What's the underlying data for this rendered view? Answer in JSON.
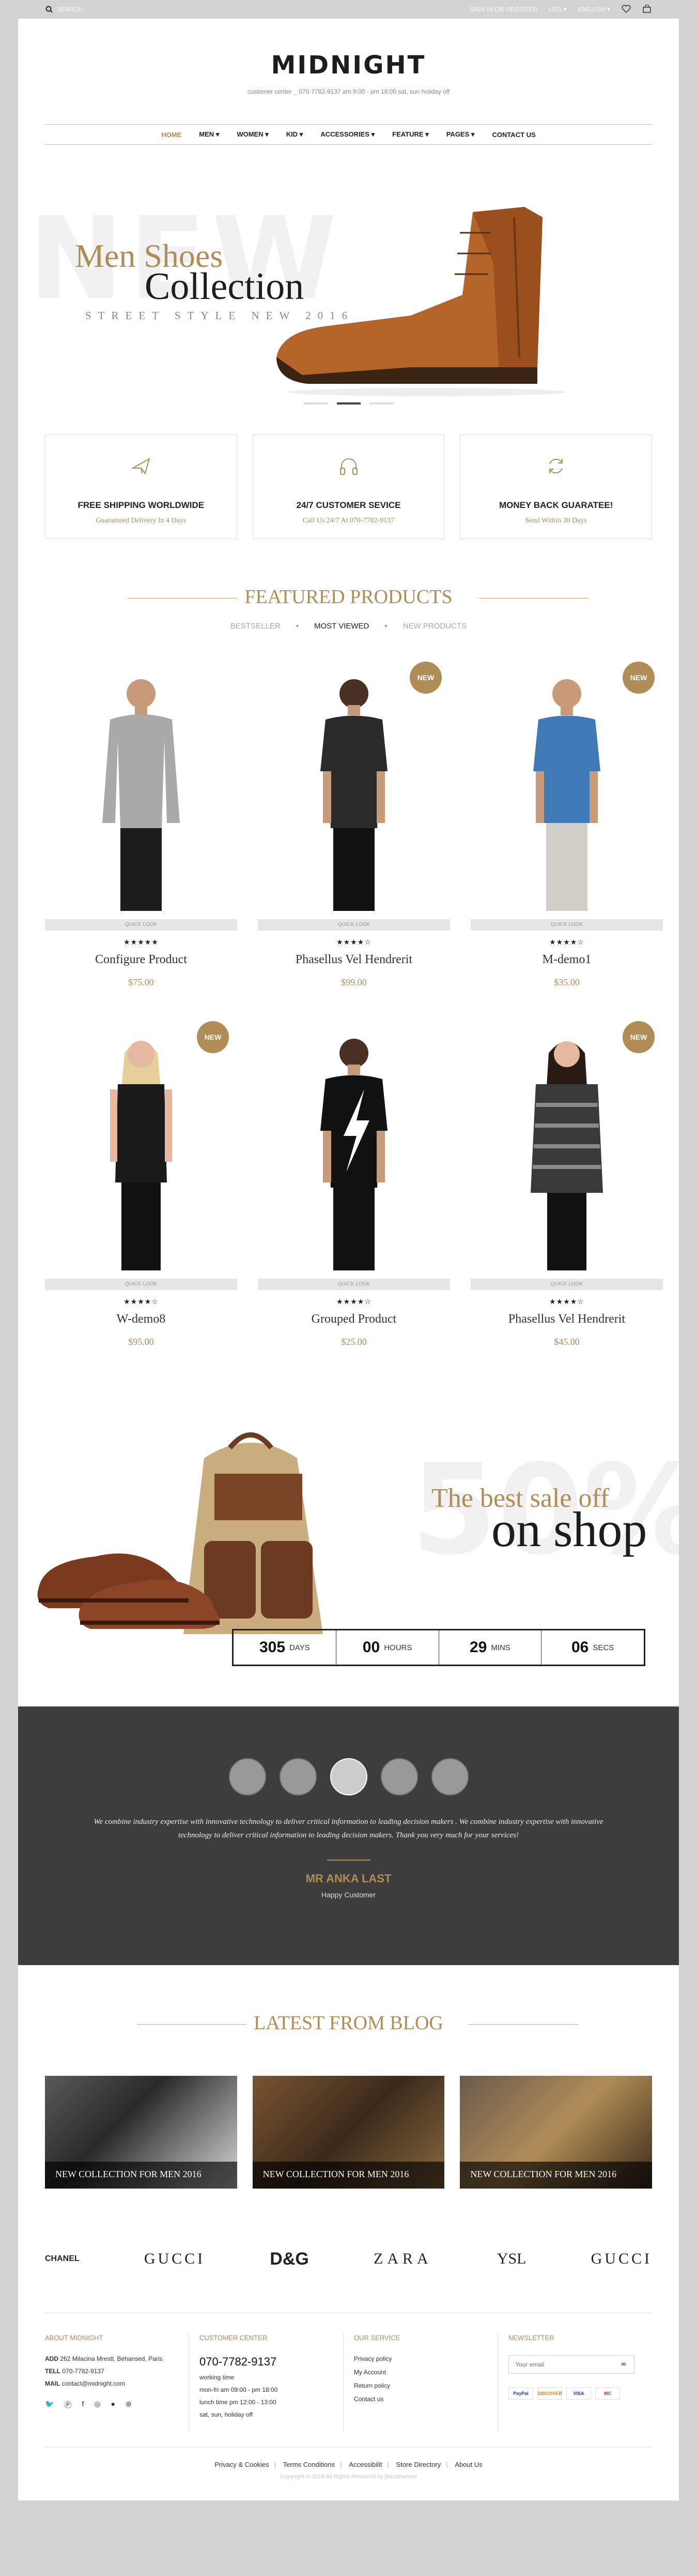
{
  "topbar": {
    "search_label": "SEARCH",
    "signin": "SIGN IN OR REGISTER",
    "currency": "USD",
    "language": "ENGLISH",
    "wishlist_count": "0",
    "cart_count": "0"
  },
  "header": {
    "logo": "MIDNIGHT",
    "tagline": "customer center _ 070-7782-9137 am 9:00 - pm 18:00 sat, sun holiday off"
  },
  "nav": {
    "items": [
      "HOME",
      "MEN",
      "WOMEN",
      "KID",
      "ACCESSORIES",
      "FEATURE",
      "PAGES",
      "CONTACT US"
    ],
    "dropdown_marker": "▾"
  },
  "hero": {
    "bg_word": "NEW",
    "title1": "Men Shoes",
    "title2": "Collection",
    "subtitle": "STREET STYLE NEW 2016"
  },
  "features": [
    {
      "title": "FREE SHIPPING WORLDWIDE",
      "sub": "Guaranteed Delivery In 4 Days",
      "icon": "airplane-icon"
    },
    {
      "title": "24/7 CUSTOMER SEVICE",
      "sub": "Call Us 24/7 At 070-7782-9137",
      "icon": "headphones-icon"
    },
    {
      "title": "MONEY BACK GUARATEE!",
      "sub": "Send Within 30 Days",
      "icon": "refresh-icon"
    }
  ],
  "featured": {
    "title": "FEATURED PRODUCTS",
    "tabs": [
      "BESTSELLER",
      "MOST VIEWED",
      "NEW PRODUCTS"
    ],
    "quick_look": "QUICK LOOK",
    "new_badge": "NEW",
    "products": [
      {
        "name": "Configure Product",
        "price": "$75.00",
        "rating": 5,
        "stars": "★★★★★",
        "isNew": false
      },
      {
        "name": "Phasellus Vel Hendrerit",
        "price": "$99.00",
        "rating": 4,
        "stars": "★★★★☆",
        "isNew": true
      },
      {
        "name": "M-demo1",
        "price": "$35.00",
        "rating": 4.5,
        "stars": "★★★★☆",
        "isNew": true
      },
      {
        "name": "W-demo8",
        "price": "$95.00",
        "rating": 4.5,
        "stars": "★★★★☆",
        "isNew": true
      },
      {
        "name": "Grouped Product",
        "price": "$25.00",
        "rating": 4,
        "stars": "★★★★☆",
        "isNew": false
      },
      {
        "name": "Phasellus Vel Hendrerit",
        "price": "$45.00",
        "rating": 4.5,
        "stars": "★★★★☆",
        "isNew": true
      }
    ]
  },
  "sale": {
    "bg_word": "50%",
    "title1": "The best sale off",
    "title2": "on shop",
    "countdown": [
      {
        "value": "305",
        "unit": "DAYS"
      },
      {
        "value": "00",
        "unit": "HOURS"
      },
      {
        "value": "29",
        "unit": "MINS"
      },
      {
        "value": "06",
        "unit": "SECS"
      }
    ]
  },
  "testimonial": {
    "quote": "We combine industry expertise with innovative technology to deliver critical information to leading decision makers . We combine industry expertise with innovative technology to deliver critical information to leading decision makers. Thank you very much for your services!",
    "author": "MR ANKA LAST",
    "role": "Happy Customer"
  },
  "blog": {
    "title": "LATEST FROM BLOG",
    "posts": [
      "NEW COLLECTION FOR MEN 2016",
      "NEW COLLECTION FOR MEN 2016",
      "NEW COLLECTION FOR MEN 2016"
    ]
  },
  "brands": [
    "CHANEL",
    "GUCCI",
    "D&G",
    "ZARA",
    "YSL",
    "GUCCI"
  ],
  "footer": {
    "about": {
      "title": "ABOUT MIDNIGHT",
      "add_label": "ADD",
      "add": "262 Milacina Mrestl, Behansed, Paris",
      "tell_label": "TELL",
      "tell": "070-7782-9137",
      "mail_label": "MAIL",
      "mail": "contact@midnight.com"
    },
    "center": {
      "title": "CUSTOMER CENTER",
      "phone": "070-7782-9137",
      "lines": [
        "working time",
        "mon-fri am 09:00 - pm 18:00",
        "lunch time pm 12:00 - 13:00",
        "sat, sun, holiday off"
      ]
    },
    "service": {
      "title": "OUR SERVICE",
      "links": [
        "Privacy policy",
        "My Account",
        "Return policy",
        "Contact us"
      ]
    },
    "newsletter": {
      "title": "NEWSLETTER",
      "placeholder": "Your email",
      "payments": [
        "PayPal",
        "DISCOVER",
        "VISA",
        "MC"
      ]
    }
  },
  "bottom": {
    "links": [
      "Privacy & Cookies",
      "Terms Conditions",
      "Accessibilit",
      "Store Directory",
      "About Us"
    ],
    "copyright": "Copyright © 2016 All Rights Reserved by plazathemes"
  },
  "colors": {
    "accent": "#b08d57",
    "dark": "#1d1d1d",
    "testimonial_bg": "#3d3d3d"
  }
}
